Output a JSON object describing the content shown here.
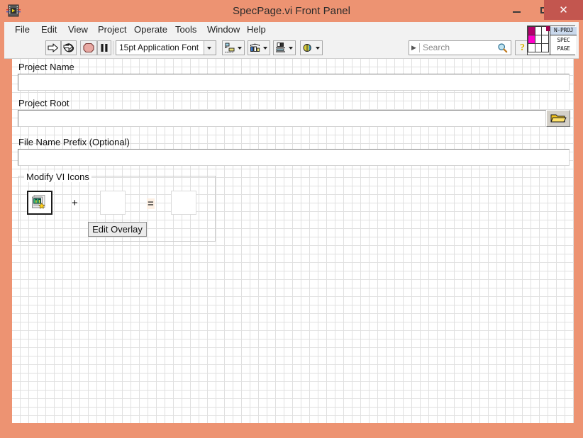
{
  "window": {
    "title": "SpecPage.vi Front Panel",
    "app_icon": "labview-vi-icon",
    "controls": {
      "minimize": "minimize-icon",
      "maximize": "maximize-icon",
      "close": "close-icon",
      "close_glyph": "✕"
    },
    "frame_color": "#ed9372",
    "close_color": "#c3564f"
  },
  "menubar": {
    "items": [
      {
        "label": "File",
        "name": "menu-file"
      },
      {
        "label": "Edit",
        "name": "menu-edit"
      },
      {
        "label": "View",
        "name": "menu-view"
      },
      {
        "label": "Project",
        "name": "menu-project"
      },
      {
        "label": "Operate",
        "name": "menu-operate"
      },
      {
        "label": "Tools",
        "name": "menu-tools"
      },
      {
        "label": "Window",
        "name": "menu-window"
      },
      {
        "label": "Help",
        "name": "menu-help"
      }
    ]
  },
  "toolbar": {
    "run_icon": "run-arrow-icon",
    "run_continuous_icon": "run-continuously-icon",
    "abort_icon": "abort-execution-icon",
    "pause_icon": "pause-icon",
    "font_selector": "15pt Application Font",
    "align_icon": "align-objects-icon",
    "distribute_icon": "distribute-objects-icon",
    "resize_icon": "resize-objects-icon",
    "reorder_icon": "reorder-objects-icon",
    "search": {
      "placeholder": "Search",
      "value": "",
      "icon": "magnifier-icon"
    },
    "help_icon": "context-help-icon",
    "help_glyph": "?"
  },
  "vi_badge": {
    "line1": "N-PROJ",
    "line2": "SPEC",
    "line3": "PAGE",
    "header_color": "#c9d8ec",
    "swatch_colors": [
      "#b3006b",
      "#ff00c8",
      "#a3004f"
    ]
  },
  "panel": {
    "background": "#ffffff",
    "grid_color": "#e0e0e0",
    "grid_size": 12,
    "controls": [
      {
        "name": "project-name",
        "label": "Project Name",
        "value": "",
        "type": "string"
      },
      {
        "name": "project-root",
        "label": "Project Root",
        "value": "",
        "type": "path",
        "browse_icon": "folder-open-icon"
      },
      {
        "name": "file-name-prefix",
        "label": "File Name Prefix (Optional)",
        "value": "",
        "type": "string"
      }
    ],
    "group": {
      "name": "modify-vi-icons",
      "title": "Modify VI Icons",
      "source_icon": "vi-icon-thumbnail",
      "overlay_icon": "",
      "result_icon": "",
      "plus_sign": "+",
      "equals_sign": "=",
      "edit_button": "Edit Overlay"
    }
  }
}
